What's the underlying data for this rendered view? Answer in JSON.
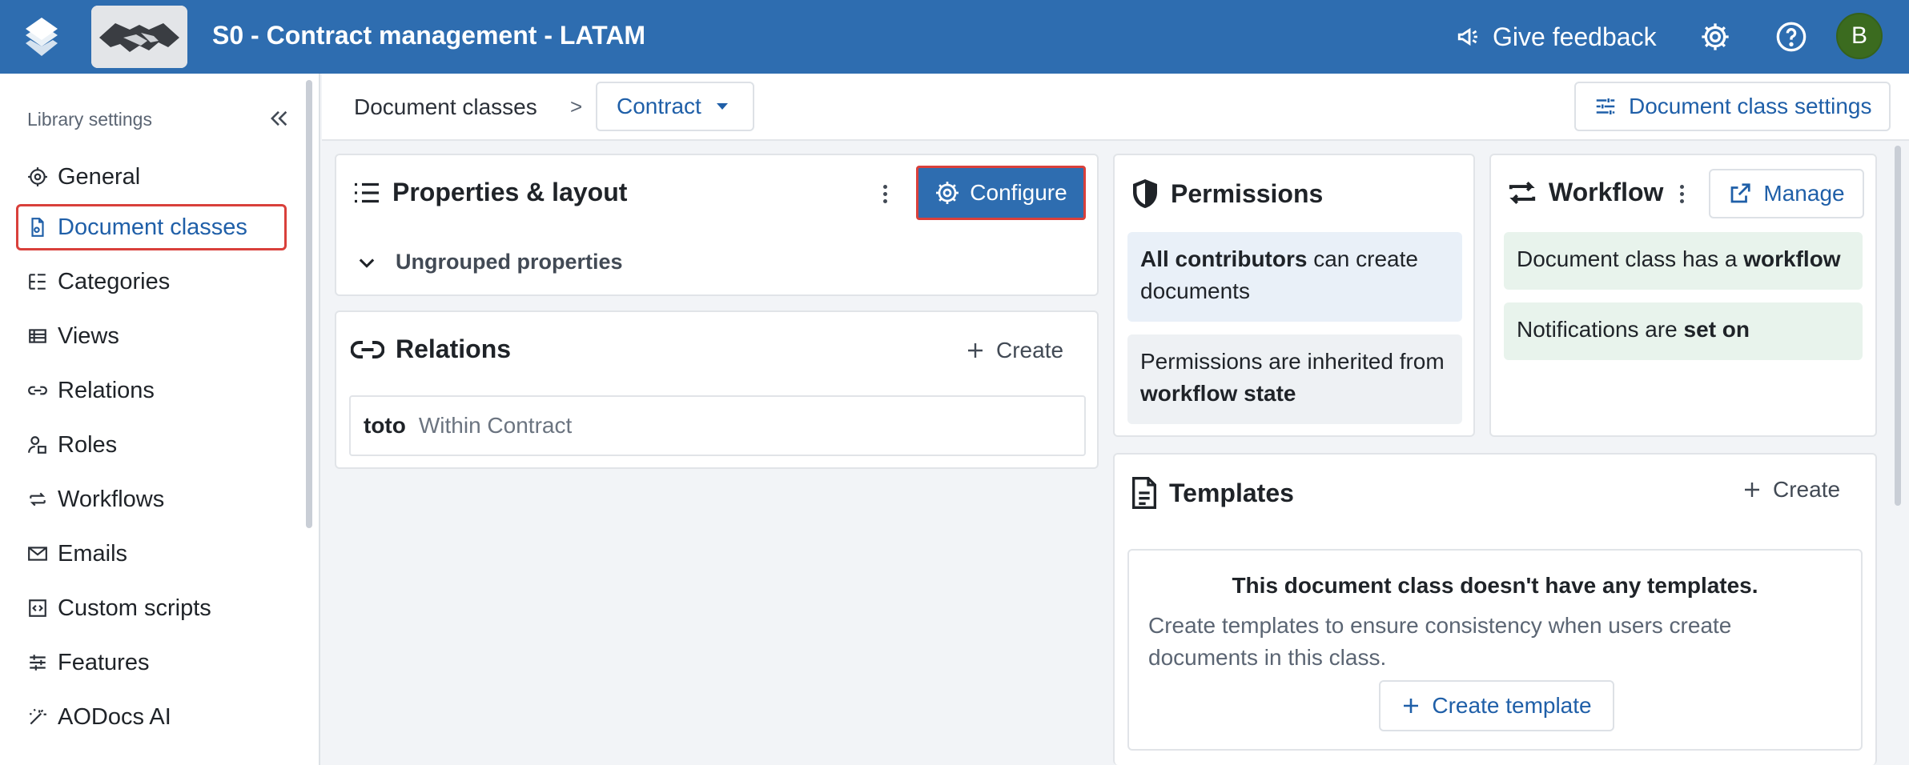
{
  "app": {
    "library_title": "S0 - Contract management - LATAM",
    "feedback_label": "Give feedback",
    "avatar_initial": "B",
    "brand_color": "#2e6db0"
  },
  "sidebar": {
    "heading": "Library settings",
    "items": [
      {
        "label": "General",
        "icon": "gear-icon"
      },
      {
        "label": "Document classes",
        "icon": "document-class-icon",
        "active": true
      },
      {
        "label": "Categories",
        "icon": "categories-icon"
      },
      {
        "label": "Views",
        "icon": "views-icon"
      },
      {
        "label": "Relations",
        "icon": "link-icon"
      },
      {
        "label": "Roles",
        "icon": "roles-icon"
      },
      {
        "label": "Workflows",
        "icon": "workflow-icon"
      },
      {
        "label": "Emails",
        "icon": "mail-icon"
      },
      {
        "label": "Custom scripts",
        "icon": "code-icon"
      },
      {
        "label": "Features",
        "icon": "sliders-icon"
      },
      {
        "label": "AODocs AI",
        "icon": "magic-wand-icon"
      }
    ]
  },
  "breadcrumb": {
    "root": "Document classes",
    "separator": ">",
    "current": "Contract",
    "settings_button": "Document class settings"
  },
  "properties": {
    "title": "Properties & layout",
    "configure_label": "Configure",
    "group_label": "Ungrouped properties"
  },
  "relations": {
    "title": "Relations",
    "create_label": "Create",
    "rows": [
      {
        "name": "toto",
        "description": "Within Contract"
      }
    ]
  },
  "permissions": {
    "title": "Permissions",
    "box1_strong": "All contributors",
    "box1_rest": " can create documents",
    "box2_text": "Permissions are inherited from ",
    "box2_strong": "workflow state"
  },
  "workflow": {
    "title": "Workflow",
    "manage_label": "Manage",
    "box1_text": "Document class has a ",
    "box1_strong": "workflow",
    "box2_text": "Notifications are ",
    "box2_strong": "set on"
  },
  "templates": {
    "title": "Templates",
    "create_label": "Create",
    "empty_title": "This document class doesn't have any templates.",
    "empty_desc": "Create templates to ensure consistency when users create documents in this class.",
    "create_template_label": "Create template"
  }
}
